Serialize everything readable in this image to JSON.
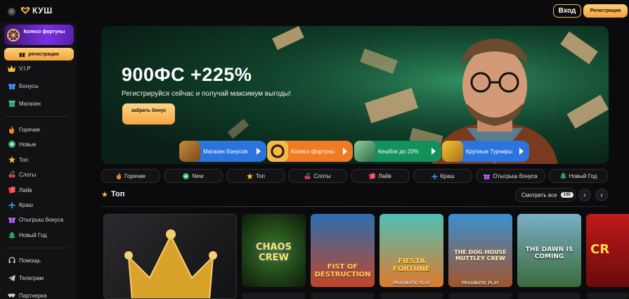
{
  "topbar": {
    "close_icon": "×",
    "logo_text": "КУШ",
    "login_label": "Вход",
    "register_label": "Регистрация"
  },
  "sidebar": {
    "wheel_card_label": "Колесо фортуны",
    "register_label": "регистрация",
    "items_top": [
      {
        "label": "V.I.P",
        "icon": "crown-icon"
      },
      {
        "label": "Бонусы",
        "icon": "gift-icon"
      },
      {
        "label": "Магазин",
        "icon": "shop-icon"
      }
    ],
    "items_games": [
      {
        "label": "Горячие",
        "icon": "fire-icon"
      },
      {
        "label": "Новые",
        "icon": "plus-circle-icon"
      },
      {
        "label": "Топ",
        "icon": "star-icon"
      },
      {
        "label": "Слоты",
        "icon": "cherry-icon"
      },
      {
        "label": "Лайв",
        "icon": "chip-icon"
      },
      {
        "label": "Краш",
        "icon": "plane-icon"
      },
      {
        "label": "Отыгрыш бонуса",
        "icon": "gift-icon"
      },
      {
        "label": "Новый Год",
        "icon": "tree-icon"
      }
    ],
    "items_bottom": [
      {
        "label": "Помощь",
        "icon": "headset-icon"
      },
      {
        "label": "Телеграм",
        "icon": "telegram-icon"
      },
      {
        "label": "Партнерка",
        "icon": "handshake-icon"
      }
    ]
  },
  "hero": {
    "title": "900ФС +225%",
    "subtitle": "Регистрируйся сейчас и получай максимум выгоды!",
    "cta_label": "забрать бонус",
    "pills": [
      {
        "label": "Магазин бонусов",
        "color": "#2b74e0"
      },
      {
        "label": "Колесо фортуны",
        "color": "#f07b23"
      },
      {
        "label": "Кешбок до 20%",
        "color": "#12925a"
      },
      {
        "label": "Крупные Турниры",
        "color": "#2b74e0"
      }
    ]
  },
  "categories": [
    {
      "label": "Горячие",
      "icon": "fire-icon"
    },
    {
      "label": "New",
      "icon": "plus-circle-icon"
    },
    {
      "label": "Топ",
      "icon": "star-icon"
    },
    {
      "label": "Слоты",
      "icon": "cherry-icon"
    },
    {
      "label": "Лайв",
      "icon": "chip-icon"
    },
    {
      "label": "Краш",
      "icon": "plane-icon"
    },
    {
      "label": "Отыгрыш бонуса",
      "icon": "gift-icon"
    },
    {
      "label": "Новый Год",
      "icon": "tree-icon"
    }
  ],
  "section": {
    "title": "Топ",
    "see_all_label": "Смотреть все",
    "see_all_count": "130",
    "prev_icon": "‹",
    "next_icon": "›"
  },
  "games": [
    {
      "title": "CHAOS CREW",
      "provider": ""
    },
    {
      "title": "FIST OF DESTRUCTION",
      "provider": ""
    },
    {
      "title": "FIESTA FORTUNE",
      "provider": "PRAGMATIC PLAY"
    },
    {
      "title": "THE DOG HOUSE MUTTLEY CREW",
      "provider": "PRAGMATIC PLAY"
    },
    {
      "title": "THE DAWN IS COMING",
      "provider": ""
    },
    {
      "title": "CR",
      "provider": ""
    }
  ],
  "colors": {
    "accent": "#f3a23b",
    "sidebar_bg": "#121215",
    "page_bg": "#0b0b0d"
  }
}
